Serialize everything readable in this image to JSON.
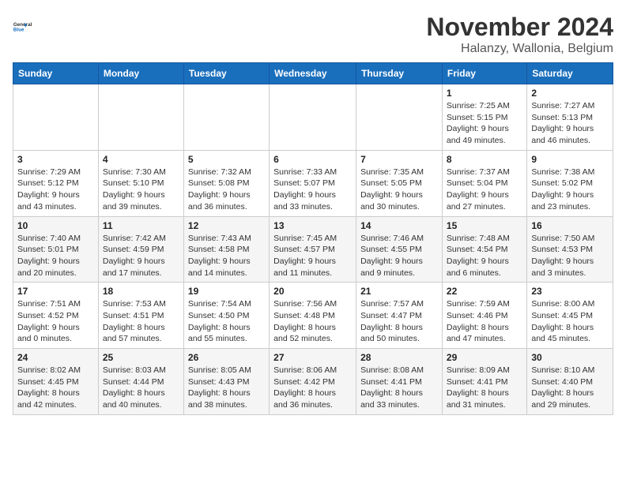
{
  "logo": {
    "line1": "General",
    "line2": "Blue"
  },
  "title": "November 2024",
  "location": "Halanzy, Wallonia, Belgium",
  "weekdays": [
    "Sunday",
    "Monday",
    "Tuesday",
    "Wednesday",
    "Thursday",
    "Friday",
    "Saturday"
  ],
  "weeks": [
    [
      {
        "day": "",
        "info": ""
      },
      {
        "day": "",
        "info": ""
      },
      {
        "day": "",
        "info": ""
      },
      {
        "day": "",
        "info": ""
      },
      {
        "day": "",
        "info": ""
      },
      {
        "day": "1",
        "info": "Sunrise: 7:25 AM\nSunset: 5:15 PM\nDaylight: 9 hours\nand 49 minutes."
      },
      {
        "day": "2",
        "info": "Sunrise: 7:27 AM\nSunset: 5:13 PM\nDaylight: 9 hours\nand 46 minutes."
      }
    ],
    [
      {
        "day": "3",
        "info": "Sunrise: 7:29 AM\nSunset: 5:12 PM\nDaylight: 9 hours\nand 43 minutes."
      },
      {
        "day": "4",
        "info": "Sunrise: 7:30 AM\nSunset: 5:10 PM\nDaylight: 9 hours\nand 39 minutes."
      },
      {
        "day": "5",
        "info": "Sunrise: 7:32 AM\nSunset: 5:08 PM\nDaylight: 9 hours\nand 36 minutes."
      },
      {
        "day": "6",
        "info": "Sunrise: 7:33 AM\nSunset: 5:07 PM\nDaylight: 9 hours\nand 33 minutes."
      },
      {
        "day": "7",
        "info": "Sunrise: 7:35 AM\nSunset: 5:05 PM\nDaylight: 9 hours\nand 30 minutes."
      },
      {
        "day": "8",
        "info": "Sunrise: 7:37 AM\nSunset: 5:04 PM\nDaylight: 9 hours\nand 27 minutes."
      },
      {
        "day": "9",
        "info": "Sunrise: 7:38 AM\nSunset: 5:02 PM\nDaylight: 9 hours\nand 23 minutes."
      }
    ],
    [
      {
        "day": "10",
        "info": "Sunrise: 7:40 AM\nSunset: 5:01 PM\nDaylight: 9 hours\nand 20 minutes."
      },
      {
        "day": "11",
        "info": "Sunrise: 7:42 AM\nSunset: 4:59 PM\nDaylight: 9 hours\nand 17 minutes."
      },
      {
        "day": "12",
        "info": "Sunrise: 7:43 AM\nSunset: 4:58 PM\nDaylight: 9 hours\nand 14 minutes."
      },
      {
        "day": "13",
        "info": "Sunrise: 7:45 AM\nSunset: 4:57 PM\nDaylight: 9 hours\nand 11 minutes."
      },
      {
        "day": "14",
        "info": "Sunrise: 7:46 AM\nSunset: 4:55 PM\nDaylight: 9 hours\nand 9 minutes."
      },
      {
        "day": "15",
        "info": "Sunrise: 7:48 AM\nSunset: 4:54 PM\nDaylight: 9 hours\nand 6 minutes."
      },
      {
        "day": "16",
        "info": "Sunrise: 7:50 AM\nSunset: 4:53 PM\nDaylight: 9 hours\nand 3 minutes."
      }
    ],
    [
      {
        "day": "17",
        "info": "Sunrise: 7:51 AM\nSunset: 4:52 PM\nDaylight: 9 hours\nand 0 minutes."
      },
      {
        "day": "18",
        "info": "Sunrise: 7:53 AM\nSunset: 4:51 PM\nDaylight: 8 hours\nand 57 minutes."
      },
      {
        "day": "19",
        "info": "Sunrise: 7:54 AM\nSunset: 4:50 PM\nDaylight: 8 hours\nand 55 minutes."
      },
      {
        "day": "20",
        "info": "Sunrise: 7:56 AM\nSunset: 4:48 PM\nDaylight: 8 hours\nand 52 minutes."
      },
      {
        "day": "21",
        "info": "Sunrise: 7:57 AM\nSunset: 4:47 PM\nDaylight: 8 hours\nand 50 minutes."
      },
      {
        "day": "22",
        "info": "Sunrise: 7:59 AM\nSunset: 4:46 PM\nDaylight: 8 hours\nand 47 minutes."
      },
      {
        "day": "23",
        "info": "Sunrise: 8:00 AM\nSunset: 4:45 PM\nDaylight: 8 hours\nand 45 minutes."
      }
    ],
    [
      {
        "day": "24",
        "info": "Sunrise: 8:02 AM\nSunset: 4:45 PM\nDaylight: 8 hours\nand 42 minutes."
      },
      {
        "day": "25",
        "info": "Sunrise: 8:03 AM\nSunset: 4:44 PM\nDaylight: 8 hours\nand 40 minutes."
      },
      {
        "day": "26",
        "info": "Sunrise: 8:05 AM\nSunset: 4:43 PM\nDaylight: 8 hours\nand 38 minutes."
      },
      {
        "day": "27",
        "info": "Sunrise: 8:06 AM\nSunset: 4:42 PM\nDaylight: 8 hours\nand 36 minutes."
      },
      {
        "day": "28",
        "info": "Sunrise: 8:08 AM\nSunset: 4:41 PM\nDaylight: 8 hours\nand 33 minutes."
      },
      {
        "day": "29",
        "info": "Sunrise: 8:09 AM\nSunset: 4:41 PM\nDaylight: 8 hours\nand 31 minutes."
      },
      {
        "day": "30",
        "info": "Sunrise: 8:10 AM\nSunset: 4:40 PM\nDaylight: 8 hours\nand 29 minutes."
      }
    ]
  ]
}
